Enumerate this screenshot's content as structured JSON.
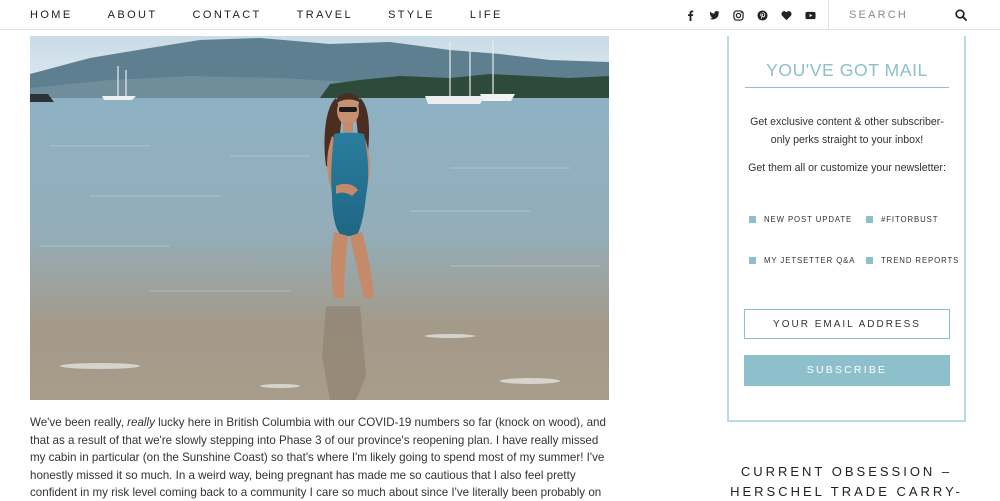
{
  "nav": {
    "items": [
      "HOME",
      "ABOUT",
      "CONTACT",
      "TRAVEL",
      "STYLE",
      "LIFE"
    ]
  },
  "social": {
    "icons": [
      "facebook-icon",
      "twitter-icon",
      "instagram-icon",
      "pinterest-icon",
      "bloglovin-heart-icon",
      "youtube-icon"
    ]
  },
  "search": {
    "placeholder": "SEARCH"
  },
  "post": {
    "paragraph_start": "We've been really, ",
    "paragraph_em": "really",
    "paragraph_rest": " lucky here in British Columbia with our COVID-19 numbers so far (knock on wood), and that as a result of that we're slowly stepping into Phase 3 of our province's reopening plan. I have really missed my cabin in particular (on the Sunshine Coast) so that's where I'm likely going to spend most of my summer! I've honestly missed it so much. In a weird way, being pregnant has made me so cautious that I also feel pretty confident in my risk level coming back to a community I care so much about since I've literally been probably on"
  },
  "newsletter": {
    "title": "YOU'VE GOT MAIL",
    "description": "Get exclusive content & other subscriber-only perks straight to your inbox!",
    "subtext": "Get them all or customize your newsletter:",
    "options": [
      "NEW POST UPDATE",
      "#FITORBUST",
      "MY JETSETTER Q&A",
      "TREND REPORTS"
    ],
    "email_placeholder": "YOUR EMAIL ADDRESS",
    "subscribe_label": "SUBSCRIBE"
  },
  "sidebar": {
    "obsession_title": "CURRENT OBSESSION – HERSCHEL TRADE CARRY-ON"
  },
  "colors": {
    "accent": "#8dc0ca",
    "border": "#b9dbe1",
    "text": "#333333"
  }
}
